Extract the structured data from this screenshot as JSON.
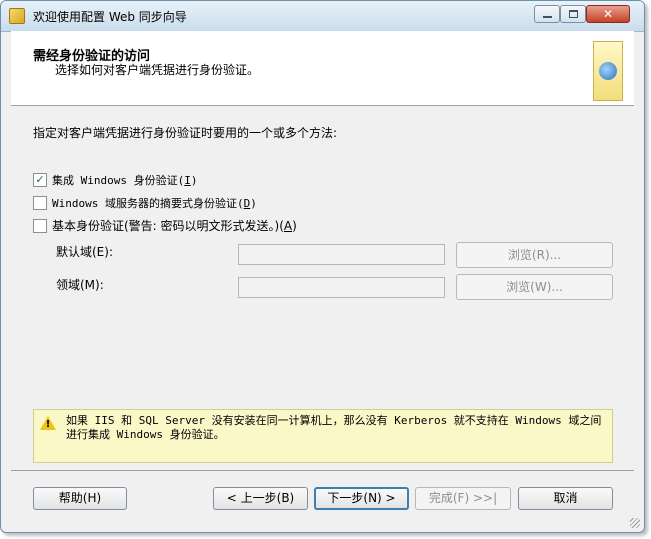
{
  "window": {
    "title": "欢迎使用配置 Web 同步向导",
    "controls": {
      "minimize": "—",
      "maximize": "□",
      "close": "✕"
    }
  },
  "header": {
    "title": "需经身份验证的访问",
    "subtitle": "选择如何对客户端凭据进行身份验证。"
  },
  "body": {
    "instruction": "指定对客户端凭据进行身份验证时要用的一个或多个方法:",
    "options": [
      {
        "label_prefix": "集成 Windows 身份验证(",
        "hotkey": "I",
        "label_suffix": ")",
        "checked": true
      },
      {
        "label_prefix": "Windows 域服务器的摘要式身份验证(",
        "hotkey": "D",
        "label_suffix": ")",
        "checked": false
      },
      {
        "label_prefix": "基本身份验证(警告: 密码以明文形式发送。)(",
        "hotkey": "A",
        "label_suffix": ")",
        "checked": false
      }
    ],
    "default_domain_label": "默认域(E):",
    "realm_label": "领域(M):",
    "browse_default": "浏览(R)...",
    "browse_realm": "浏览(W)...",
    "warning_text": "如果 IIS 和 SQL Server 没有安装在同一计算机上，那么没有 Kerberos 就不支持在 Windows 域之间进行集成 Windows 身份验证。"
  },
  "footer": {
    "help": "帮助(H)",
    "back": "< 上一步(B)",
    "next": "下一步(N) >",
    "finish": "完成(F) >>|",
    "cancel": "取消"
  },
  "icons": {
    "warning": "warning-icon",
    "wizard": "web-sync-icon",
    "check_mark": "✓"
  }
}
